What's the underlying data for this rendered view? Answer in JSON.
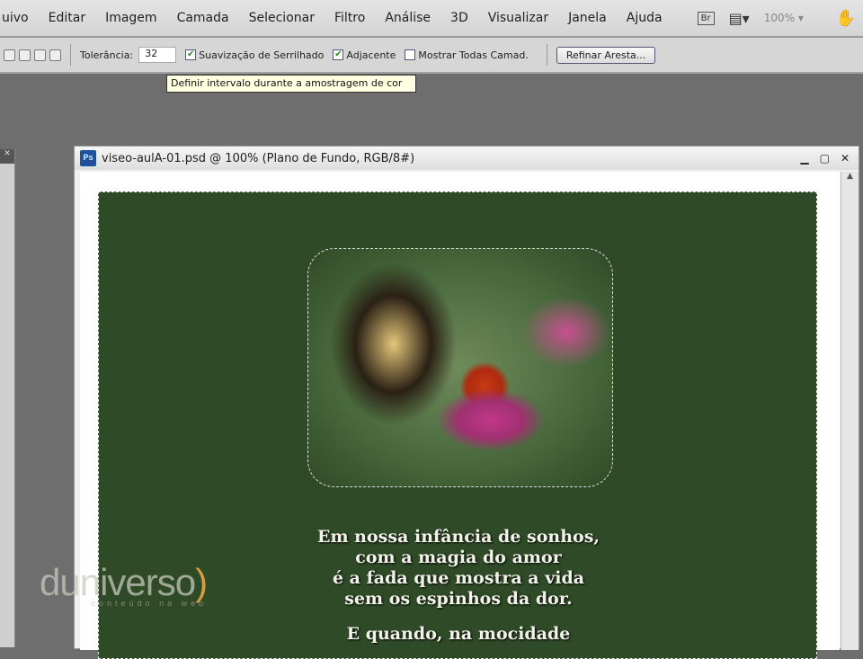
{
  "menu": [
    "uivo",
    "Editar",
    "Imagem",
    "Camada",
    "Selecionar",
    "Filtro",
    "Análise",
    "3D",
    "Visualizar",
    "Janela",
    "Ajuda"
  ],
  "menu_right": {
    "bridge": "Br",
    "zoom": "100%"
  },
  "options": {
    "tolerance_label": "Tolerância:",
    "tolerance_value": "32",
    "antialias": "Suavização de Serrilhado",
    "contiguous": "Adjacente",
    "sample_all": "Mostrar Todas Camad.",
    "refine": "Refinar Aresta..."
  },
  "tooltip": "Definir intervalo durante a amostragem de cor",
  "document": {
    "title": "viseo-aulA-01.psd @ 100% (Plano de Fundo, RGB/8#)",
    "app_icon": "Ps"
  },
  "poem": [
    "Em nossa infância de sonhos,",
    "com a magia do amor",
    "é a fada que mostra a vida",
    "sem os espinhos da dor.",
    "E quando, na mocidade"
  ],
  "watermark": {
    "brand": "duniverso",
    "tagline": "conteúdo na web"
  }
}
